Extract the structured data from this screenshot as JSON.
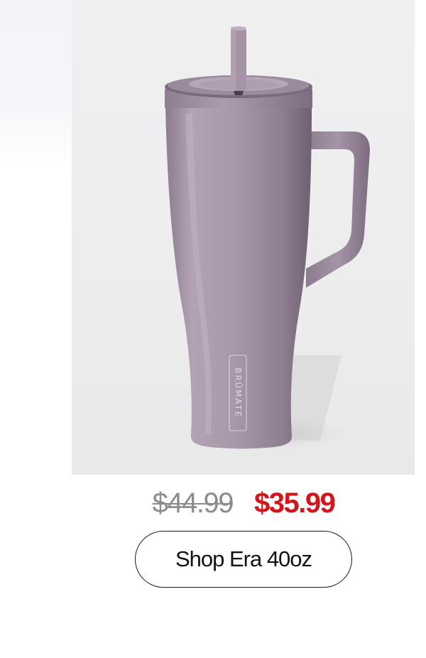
{
  "product": {
    "image_alt": "BruMate Era 40oz tumbler with straw and handle",
    "brand_mark": "BRÜMATE",
    "colors": {
      "tumbler_body": "#a796a8",
      "panel_background": "#eeeeef"
    }
  },
  "pricing": {
    "original_price": "$44.99",
    "sale_price": "$35.99",
    "colors": {
      "original": "#8c8c8c",
      "sale": "#d2161b"
    }
  },
  "cta": {
    "label": "Shop Era 40oz"
  }
}
